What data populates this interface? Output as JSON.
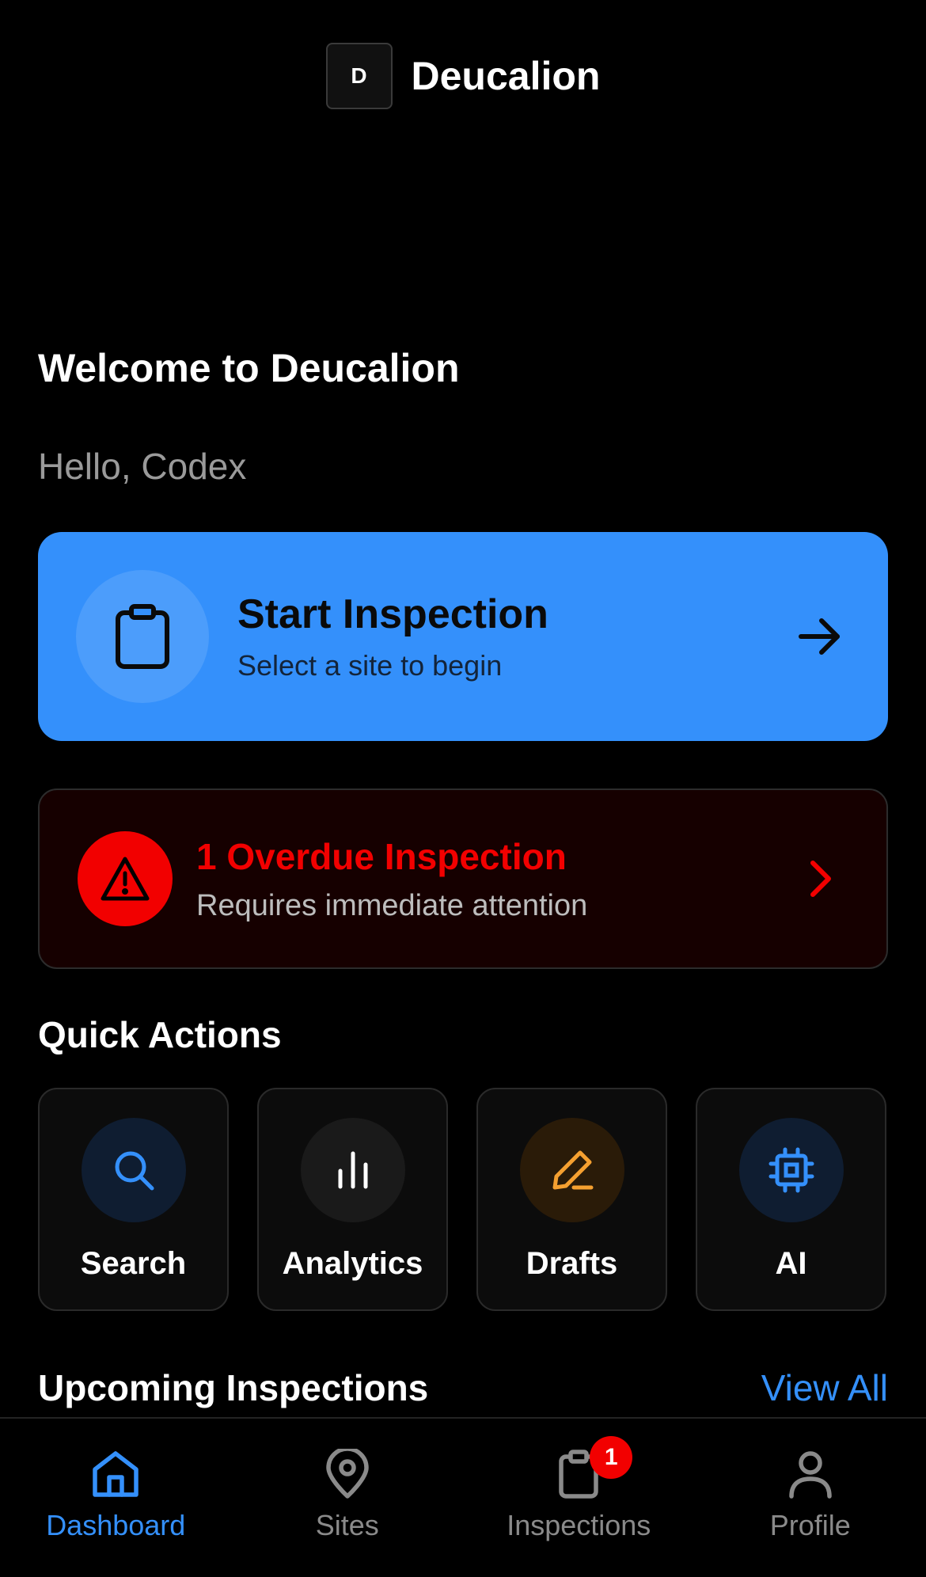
{
  "header": {
    "logo_letter": "D",
    "app_name": "Deucalion"
  },
  "welcome": {
    "title": "Welcome to Deucalion",
    "greeting": "Hello, Codex"
  },
  "start_card": {
    "title": "Start Inspection",
    "subtitle": "Select a site to begin",
    "icon": "clipboard-icon",
    "accent": "#3490fb"
  },
  "overdue_card": {
    "title": "1 Overdue Inspection",
    "subtitle": "Requires immediate attention",
    "icon": "warning-triangle-icon",
    "accent": "#f20000"
  },
  "quick_actions": {
    "title": "Quick Actions",
    "items": [
      {
        "label": "Search",
        "icon": "search-icon"
      },
      {
        "label": "Analytics",
        "icon": "bar-chart-icon"
      },
      {
        "label": "Drafts",
        "icon": "pencil-icon"
      },
      {
        "label": "AI",
        "icon": "cpu-chip-icon"
      }
    ]
  },
  "upcoming": {
    "title": "Upcoming Inspections",
    "view_all": "View All"
  },
  "bottom_nav": {
    "items": [
      {
        "label": "Dashboard",
        "icon": "home-icon",
        "active": true
      },
      {
        "label": "Sites",
        "icon": "map-pin-icon",
        "active": false
      },
      {
        "label": "Inspections",
        "icon": "clipboard-icon",
        "active": false,
        "badge": "1"
      },
      {
        "label": "Profile",
        "icon": "user-icon",
        "active": false
      }
    ]
  }
}
